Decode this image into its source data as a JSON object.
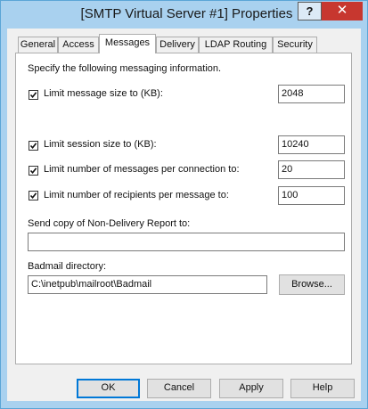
{
  "window": {
    "title": "[SMTP Virtual Server #1] Properties",
    "help_glyph": "?",
    "close_glyph": "✕"
  },
  "tabs": [
    {
      "label": "General"
    },
    {
      "label": "Access"
    },
    {
      "label": "Messages",
      "active": true
    },
    {
      "label": "Delivery"
    },
    {
      "label": "LDAP Routing"
    },
    {
      "label": "Security"
    }
  ],
  "messages": {
    "intro": "Specify the following messaging information.",
    "limits": [
      {
        "label": "Limit message size to (KB):",
        "checked": true,
        "value": "2048"
      },
      {
        "label": "Limit session size to (KB):",
        "checked": true,
        "value": "10240"
      },
      {
        "label": "Limit number of messages per connection to:",
        "checked": true,
        "value": "20"
      },
      {
        "label": "Limit number of recipients per message to:",
        "checked": true,
        "value": "100"
      }
    ],
    "ndr_label": "Send copy of Non-Delivery Report to:",
    "ndr_value": "",
    "badmail_label": "Badmail directory:",
    "badmail_value": "C:\\inetpub\\mailroot\\Badmail",
    "browse_label": "Browse..."
  },
  "footer": {
    "ok_label": "OK",
    "cancel_label": "Cancel",
    "apply_label": "Apply",
    "help_label": "Help"
  }
}
